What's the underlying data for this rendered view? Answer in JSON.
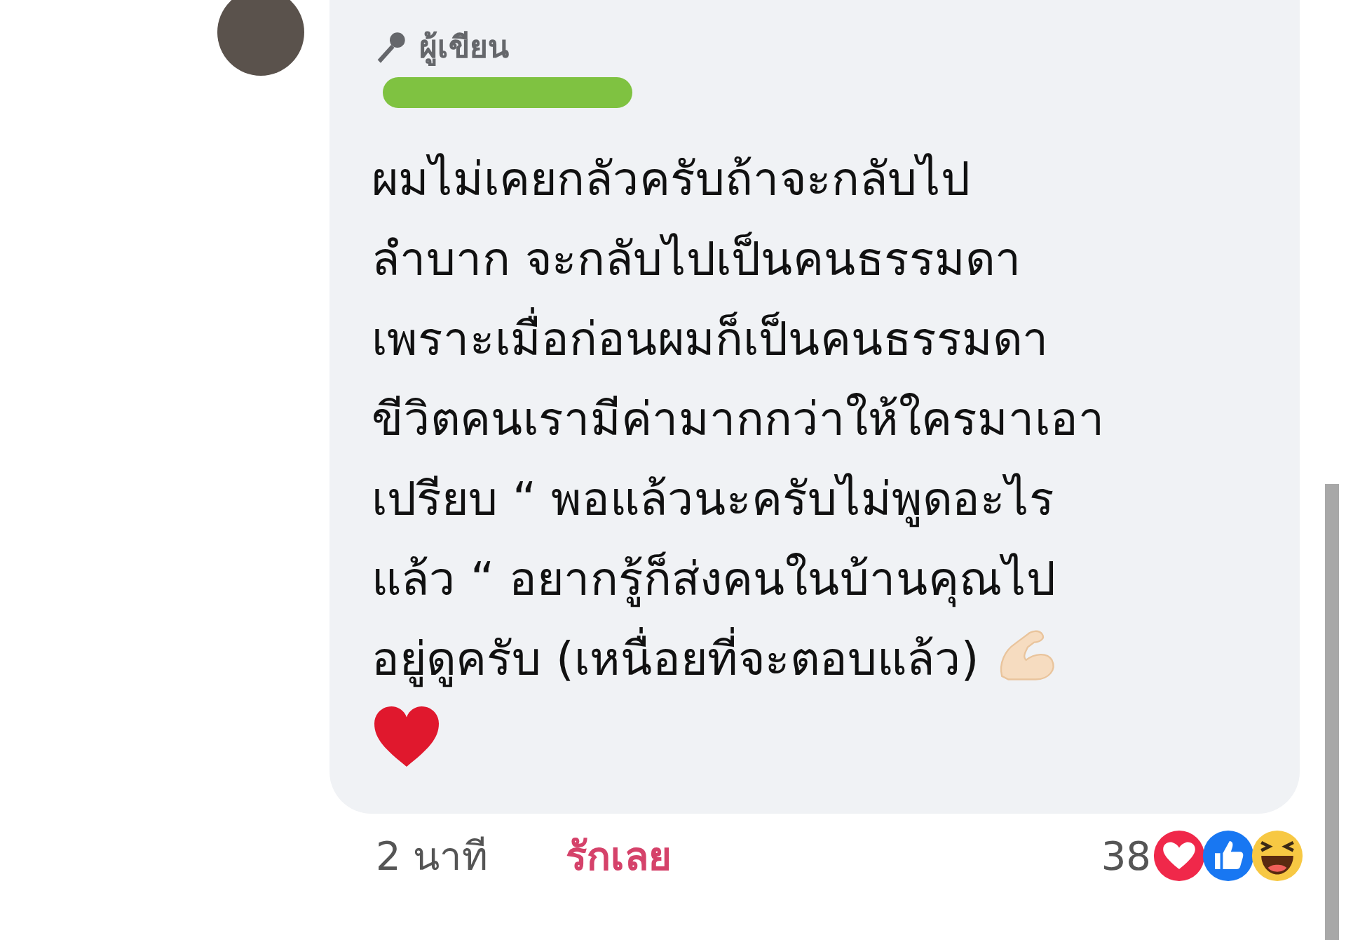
{
  "comment": {
    "badge": "ผู้เขียน",
    "text": "ผมไม่เคยกลัวครับถ้าจะกลับไป\nลำบาก จะกลับไปเป็นคนธรรมดา\nเพราะเมื่อก่อนผมก็เป็นคนธรรมดา\nขีวิตคนเรามีค่ามากกว่าให้ใครมาเอา\nเปรียบ “ พอแล้วนะครับไม่พูดอะไร\nแล้ว “ อยากรู้ก็ส่งคนในบ้านคุณไป\nอยู่ดูครับ (เหนื่อยที่จะตอบแล้ว)"
  },
  "footer": {
    "time": "2 นาที",
    "reaction_link": "รักเลย",
    "reaction_count": "38"
  }
}
